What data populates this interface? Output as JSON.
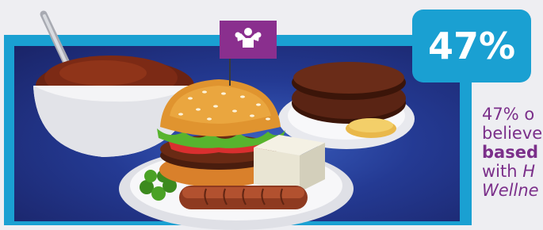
{
  "stat": {
    "value": "47%"
  },
  "caption": {
    "line1": "47% o",
    "line2": "believe",
    "line3": "based",
    "line4_prefix": "with ",
    "line4_em": "H",
    "line5": "Wellne"
  },
  "colors": {
    "frame": "#1aa0d2",
    "panel": "#243a93",
    "caption_text": "#7b2f8a",
    "flag": "#8a2f8e"
  },
  "icons": {
    "flag_icon": "flexing-muscle-icon"
  }
}
